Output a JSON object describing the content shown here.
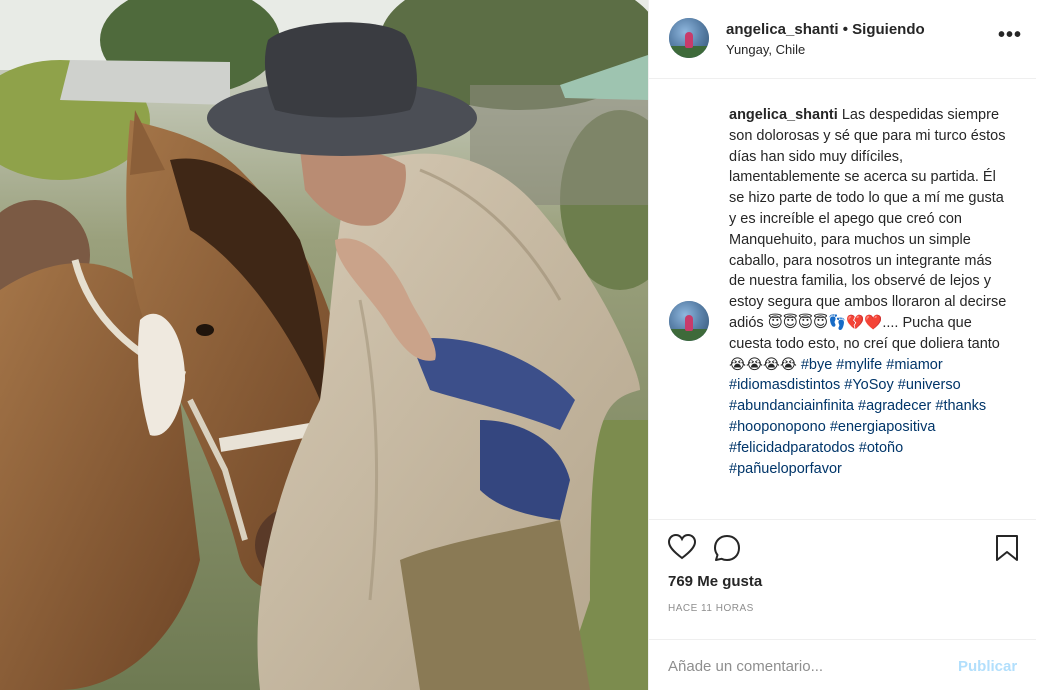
{
  "post": {
    "username": "angelica_shanti",
    "separator": "•",
    "follow_status": "Siguiendo",
    "location": "Yungay, Chile",
    "more_label": "•••",
    "caption_text": "Las despedidas siempre son dolorosas y sé que para mi turco éstos días han sido muy difíciles, lamentablemente se acerca su partida. Él se hizo parte de todo lo que a mí me gusta y es increíble el apego que creó con Manquehuito, para muchos un simple caballo, para nosotros un integrante más de nuestra familia, los observé de lejos y estoy segura que ambos lloraron al decirse adiós 😇😇😇😇👣💔❤️.... Pucha que cuesta todo esto, no creí que doliera tanto 😭😭😭😭",
    "hashtags": [
      "#bye",
      "#mylife",
      "#miamor",
      "#idiomasdistintos",
      "#YoSoy",
      "#universo",
      "#abundanciainfinita",
      "#agradecer",
      "#thanks",
      "#hooponopono",
      "#energiapositiva",
      "#felicidadparatodos",
      "#otoño",
      "#pañueloporfavor"
    ],
    "likes": "769 Me gusta",
    "time_ago": "HACE 11 HORAS",
    "comment_placeholder": "Añade un comentario...",
    "publish_label": "Publicar"
  },
  "icons": {
    "like": "heart-icon",
    "comment": "comment-icon",
    "save": "bookmark-icon",
    "more": "more-options-icon"
  },
  "colors": {
    "text": "#262626",
    "hashtag": "#003569",
    "muted": "#8e8e8e",
    "publish_disabled": "#b2dffc",
    "divider": "#efefef"
  }
}
